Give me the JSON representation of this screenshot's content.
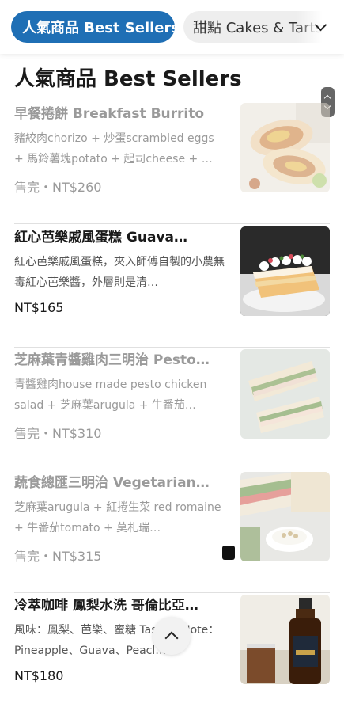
{
  "tabs": {
    "active": "人氣商品 Best Sellers",
    "next": "甜點 Cakes & Tarts"
  },
  "section": {
    "title": "人氣商品 Best Sellers"
  },
  "items": [
    {
      "name": "早餐捲餅 Breakfast Burrito",
      "desc": "豬絞肉chorizo + 炒蛋scrambled eggs + 馬鈴薯塊potato + 起司cheese + …",
      "price": "售完・NT$260"
    },
    {
      "name": "紅心芭樂戚風蛋糕 Guava…",
      "desc": "紅心芭樂戚風蛋糕，夾入師傅自製的小農無毒紅心芭樂醬，外層則是清…",
      "price": "NT$165"
    },
    {
      "name": "芝麻葉青醬雞肉三明治 Pesto…",
      "desc": "青醬雞肉house made pesto chicken salad + 芝麻葉arugula + 牛番茄…",
      "price": "售完・NT$310"
    },
    {
      "name": "蔬食總匯三明治 Vegetarian…",
      "desc": "芝麻葉arugula + 紅捲生菜 red romaine + 牛番茄tomato + 莫札瑞…",
      "price": "售完・NT$315"
    },
    {
      "name": "冷萃咖啡 鳳梨水洗 哥倫比亞…",
      "desc": "風味：鳳梨、芭樂、蜜糖 Tasting Note：Pineapple、Guava、Peacl…",
      "price": "NT$180"
    }
  ],
  "icons": {
    "tab_dropdown": "chevron-down-icon",
    "back_to_top": "chevron-up-icon",
    "scroll": "scroll-handle-icon"
  },
  "colors": {
    "accent": "#1f6fb5",
    "soldout_text": "#9a9a9a"
  }
}
